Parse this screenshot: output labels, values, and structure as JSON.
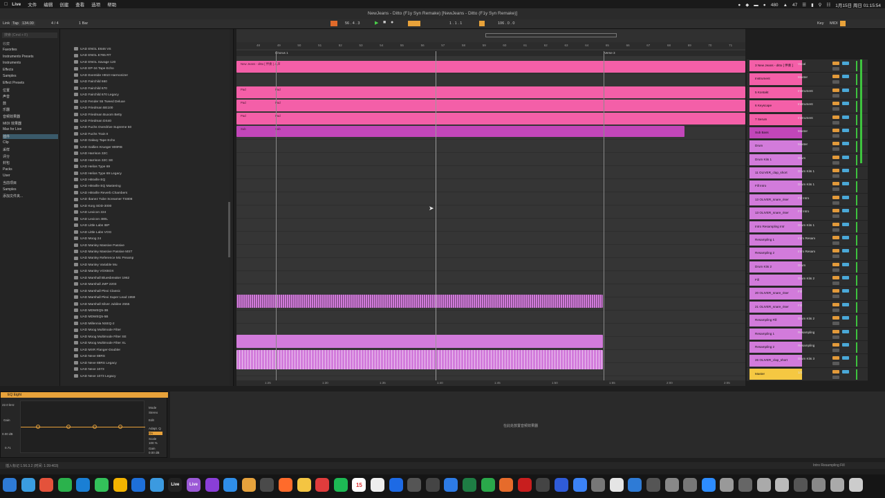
{
  "menubar": {
    "app": "Live",
    "items": [
      "文件",
      "编辑",
      "创建",
      "查看",
      "选项",
      "帮助"
    ],
    "status_num1": "480",
    "status_num2": "47",
    "clock": "1月15日 周日 01:15:54"
  },
  "window": {
    "title": "NewJeans - Ditto (F1y Syn Remake)  [NewJeans - Ditto (F1y Syn Remake)]"
  },
  "control": {
    "link": "Link",
    "tap": "Tap",
    "tempo": "134.00",
    "sig": "4 / 4",
    "bar_setting": "1 Bar",
    "position": "56 . 4 . 3",
    "loop_start": "1 . 1 . 1",
    "loop_len": "106 . 0 . 0",
    "key": "Key",
    "midi": "MIDI"
  },
  "browser": {
    "search_placeholder": "搜索 (Cmd + F)",
    "header_left": "收藏",
    "header_right": "名称",
    "categories": [
      "Favorites",
      "Instruments Presets",
      "Instruments",
      "Effects",
      "Samples",
      "Effect Presets",
      "位置",
      "声音",
      "鼓",
      "乐器",
      "音频效果器",
      "MIDI 效果器",
      "Max for Live",
      "插件",
      "Clip",
      "采样",
      "评分",
      "封包",
      "Packs",
      "User",
      "当前项目",
      "Samples",
      "添加文件夹..."
    ],
    "selected_category": "插件",
    "files": [
      "UAD ENGL E646 VS",
      "UAD ENGL E765 RT",
      "UAD ENGL Savage 120",
      "UAD EP-34 Tape Echo",
      "UAD Eventide H910 Harmonizer",
      "UAD Fairchild 660",
      "UAD Fairchild 670",
      "UAD Fairchild 670 Legacy",
      "UAD Fender 55 Tweed Deluxe",
      "UAD Friedman BE100",
      "UAD Friedman Buxom Betty",
      "UAD Friedman DS40",
      "UAD Fuchs Overdrive Supreme 50",
      "UAD Fuchs Train II",
      "UAD Galaxy Tape Echo",
      "UAD Gallien Krueger 800RB",
      "UAD Harrison 32C",
      "UAD Harrison 32C SE",
      "UAD Helios Type 69",
      "UAD Helios Type 69 Legacy",
      "UAD Hitsville EQ",
      "UAD Hitsville EQ Mastering",
      "UAD Hitsville Reverb Chambers",
      "UAD Ibanez Tube Screamer TS808",
      "UAD Korg SDD-3000",
      "UAD Lexicon 224",
      "UAD Lexicon 480L",
      "UAD Little Labs IBP",
      "UAD Little Labs VOG",
      "UAD Moog 24",
      "UAD Manley Massive Passive",
      "UAD Manley Massive Passive MST",
      "UAD Manley Reference Mic Preamp",
      "UAD Manley Variable Mu",
      "UAD Manley VOXBOX",
      "UAD Marshall Bluesbreaker 1962",
      "UAD Marshall JMP 2203",
      "UAD Marshall Plexi Classic",
      "UAD Marshall Plexi Super Lead 1959",
      "UAD Marshall Silver Jubilee 2555",
      "UAD MDWEQ5-3B",
      "UAD MDWEQ5-5B",
      "UAD Millennia NSEQ-2",
      "UAD Moog Multimode Filter",
      "UAD Moog Multimode Filter SE",
      "UAD Moog Multimode Filter XL",
      "UAD MXR Flanger-Doubler",
      "UAD Neve 88RS",
      "UAD Neve 88RS Legacy",
      "UAD Neve 1073",
      "UAD Neve 1073 Legacy"
    ]
  },
  "arrangement": {
    "ruler_bars": [
      "48",
      "49",
      "50",
      "51",
      "52",
      "53",
      "54",
      "55",
      "56",
      "57",
      "58",
      "59",
      "60",
      "61",
      "62",
      "63",
      "64",
      "65",
      "66",
      "67",
      "68",
      "69",
      "70",
      "71"
    ],
    "locators": [
      "Chorus 1",
      "Verse 3"
    ],
    "time_marks": [
      "1:25",
      "1:30",
      "1:35",
      "1:40",
      "1:45",
      "1:50",
      "1:55",
      "2:00",
      "2:05"
    ],
    "vocal_clip_label": "New Jeans - ditto [ 伴奏 ] 人声",
    "clip_labels": [
      "Pad",
      "Pad",
      "Pad",
      "Pad",
      "Pad",
      "Pad",
      "Pad",
      "Pad",
      "Sub",
      "Sub",
      "Sub"
    ]
  },
  "tracks": [
    {
      "name": "3 New Jeans - ditto [ 伴奏 ]",
      "route": "Vocal",
      "color": "#f45fa8"
    },
    {
      "name": "Instrument",
      "route": "Master",
      "color": "#f45fa8"
    },
    {
      "name": "5 Kontakt",
      "route": "Instrument",
      "color": "#f45fa8"
    },
    {
      "name": "6 Keyscape",
      "route": "Instrument",
      "color": "#f45fa8"
    },
    {
      "name": "7 Serum",
      "route": "Instrument",
      "color": "#f45fa8"
    },
    {
      "name": "Sub Bass",
      "route": "Master",
      "color": "#c246b9"
    },
    {
      "name": "Drum",
      "route": "Master",
      "color": "#d27bdb"
    },
    {
      "name": "Drum Kits 1",
      "route": "Drum",
      "color": "#d27bdb"
    },
    {
      "name": "11 OLIVER_clap_short",
      "route": "Drum Kits 1",
      "color": "#d27bdb"
    },
    {
      "name": "Fill Intro",
      "route": "Drum Kits 1",
      "color": "#d27bdb"
    },
    {
      "name": "13 OLIVER_snare_riser",
      "route": "Fill Intro",
      "color": "#d27bdb"
    },
    {
      "name": "13 OLIVER_snare_riser",
      "route": "Fill Intro",
      "color": "#d27bdb"
    },
    {
      "name": "Intro Resampling Intr",
      "route": "Drum Kits 1",
      "color": "#d27bdb"
    },
    {
      "name": "Resampling 1",
      "route": "Intro Resam",
      "color": "#d27bdb"
    },
    {
      "name": "Resampling 2",
      "route": "Intro Resam",
      "color": "#d27bdb"
    },
    {
      "name": "Drum Kits 2",
      "route": "Drum",
      "color": "#d27bdb"
    },
    {
      "name": "Fill",
      "route": "Drum Kits 2",
      "color": "#d27bdb"
    },
    {
      "name": "20 OLIVER_snare_riser",
      "route": "Fill",
      "color": "#d27bdb"
    },
    {
      "name": "21 OLIVER_snare_riser",
      "route": "Fill",
      "color": "#d27bdb"
    },
    {
      "name": "Resampling Fill",
      "route": "Drum Kits 2",
      "color": "#d27bdb"
    },
    {
      "name": "Resampling 1",
      "route": "Resampling",
      "color": "#d27bdb"
    },
    {
      "name": "Resampling 2",
      "route": "Resampling",
      "color": "#d27bdb"
    },
    {
      "name": "26 OLIVER_clap_short",
      "route": "Drum Kits 3",
      "color": "#d27bdb"
    },
    {
      "name": "Master",
      "route": "1/2",
      "color": "#f5c842"
    }
  ],
  "device": {
    "name": "EQ Eight",
    "freq": "22.0 kHz",
    "gain_label": "Gain",
    "gain": "0.00 dB",
    "q": "0.71",
    "mode_label": "Mode",
    "mode": "Stereo",
    "edit": "Edit",
    "adapt_q": "Adapt. Q",
    "on": "On",
    "scale_label": "Scale",
    "scale": "100 %",
    "out_gain_label": "Gain",
    "out_gain": "0.00 dB",
    "drop_hint": "在此处放置音频效果器"
  },
  "status": {
    "left": "插入标记 1.56.3.2 (时间: 1:39:403)",
    "right": "Intro Resampling Fill"
  },
  "dock": {
    "live_label": "Live",
    "calendar_day": "15"
  },
  "colors": {
    "pink": "#f45fa8",
    "purple": "#c246b9",
    "lavender": "#d27bdb",
    "orange": "#e39a3a",
    "master": "#f5c842"
  }
}
